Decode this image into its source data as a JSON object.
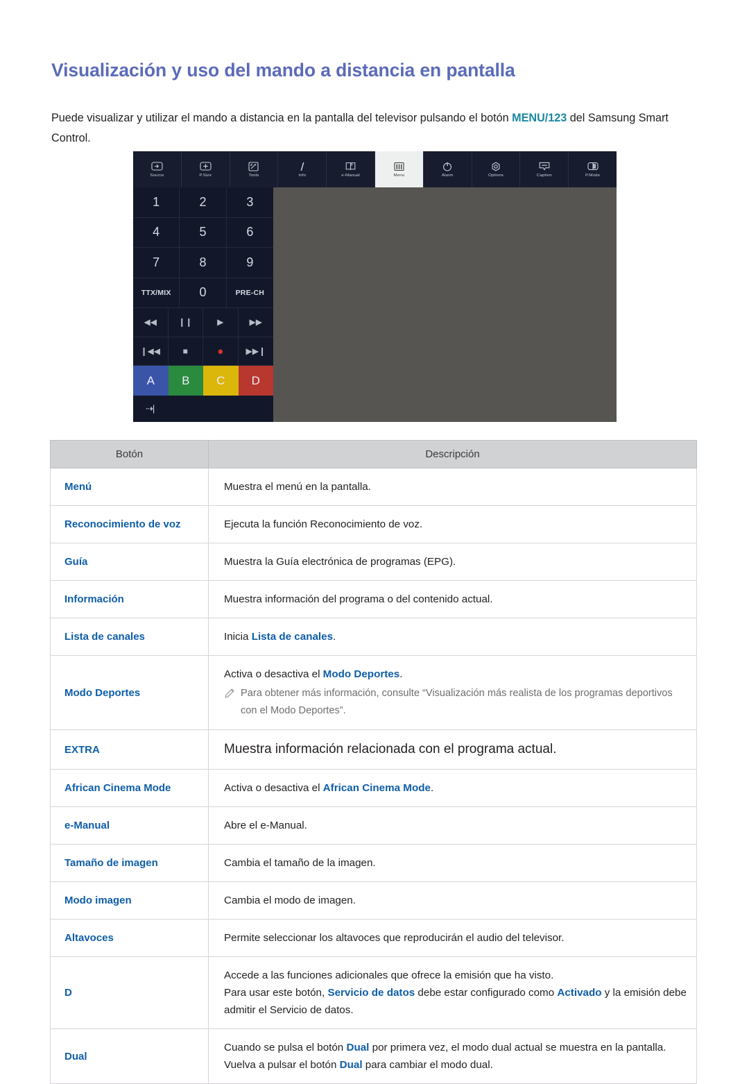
{
  "page": {
    "title": "Visualización y uso del mando a distancia en pantalla",
    "intro_before": "Puede visualizar y utilizar el mando a distancia en la pantalla del televisor pulsando el botón ",
    "intro_key": "MENU/123",
    "intro_after": " del Samsung Smart Control."
  },
  "colors": {
    "heading": "#5b6bb8",
    "key_accent": "#1a87a2",
    "link": "#0f5ea8",
    "table_header_bg": "#d0d2d3",
    "remote_panel_bg": "#575552",
    "remote_dark": "#121829",
    "color_a": "#3a54a8",
    "color_b": "#2a8a3e",
    "color_c": "#dbb60b",
    "color_d": "#b8372f"
  },
  "remote": {
    "topbar": [
      {
        "label": "Source",
        "icon": "source-icon",
        "active": false
      },
      {
        "label": "P.Size",
        "icon": "picture-size-icon",
        "active": false
      },
      {
        "label": "Tools",
        "icon": "tools-icon",
        "active": false
      },
      {
        "label": "Info",
        "icon": "info-icon",
        "active": false
      },
      {
        "label": "e-Manual",
        "icon": "e-manual-icon",
        "active": false
      },
      {
        "label": "Menu",
        "icon": "menu-icon",
        "active": true
      },
      {
        "label": "Alarm",
        "icon": "alarm-icon",
        "active": false
      },
      {
        "label": "Options",
        "icon": "options-icon",
        "active": false
      },
      {
        "label": "Caption",
        "icon": "caption-icon",
        "active": false
      },
      {
        "label": "P.Mode",
        "icon": "picture-mode-icon",
        "active": false
      }
    ],
    "numpad": [
      "1",
      "2",
      "3",
      "4",
      "5",
      "6",
      "7",
      "8",
      "9",
      "TTX/MIX",
      "0",
      "PRE-CH"
    ],
    "media_row1": [
      {
        "glyph": "◀◀",
        "name": "rewind"
      },
      {
        "glyph": "❙❙",
        "name": "pause"
      },
      {
        "glyph": "▶",
        "name": "play"
      },
      {
        "glyph": "▶▶",
        "name": "fast-forward"
      }
    ],
    "media_row2": [
      {
        "glyph": "❙◀◀",
        "name": "previous"
      },
      {
        "glyph": "■",
        "name": "stop"
      },
      {
        "glyph": "●",
        "name": "record"
      },
      {
        "glyph": "▶▶❙",
        "name": "next"
      }
    ],
    "color_buttons": [
      {
        "label": "A",
        "color": "#3a54a8"
      },
      {
        "label": "B",
        "color": "#2a8a3e"
      },
      {
        "label": "C",
        "color": "#dbb60b"
      },
      {
        "label": "D",
        "color": "#b8372f"
      }
    ],
    "bottom_button": {
      "label": "⇢|",
      "name": "exit-arrow"
    }
  },
  "table": {
    "headers": [
      "Botón",
      "Descripción"
    ],
    "rows": [
      {
        "name": "Menú",
        "desc_parts": [
          {
            "t": "Muestra el menú en la pantalla.",
            "link": false
          }
        ]
      },
      {
        "name": "Reconocimiento de voz",
        "desc_parts": [
          {
            "t": "Ejecuta la función Reconocimiento de voz.",
            "link": false
          }
        ]
      },
      {
        "name": "Guía",
        "desc_parts": [
          {
            "t": "Muestra la Guía electrónica de programas (EPG).",
            "link": false
          }
        ]
      },
      {
        "name": "Información",
        "desc_parts": [
          {
            "t": "Muestra información del programa o del contenido actual.",
            "link": false
          }
        ]
      },
      {
        "name": "Lista de canales",
        "desc_parts": [
          {
            "t": "Inicia ",
            "link": false
          },
          {
            "t": "Lista de canales",
            "link": true
          },
          {
            "t": ".",
            "link": false
          }
        ]
      },
      {
        "name": "Modo Deportes",
        "desc_parts": [
          {
            "t": "Activa o desactiva el ",
            "link": false
          },
          {
            "t": "Modo Deportes",
            "link": true
          },
          {
            "t": ".",
            "link": false
          }
        ],
        "note": "Para obtener más información, consulte “Visualización más realista de los programas deportivos con el Modo Deportes”."
      },
      {
        "name": "EXTRA",
        "big": true,
        "desc_parts": [
          {
            "t": "Muestra información relacionada con el programa actual.",
            "link": false
          }
        ]
      },
      {
        "name": "African Cinema Mode",
        "desc_parts": [
          {
            "t": "Activa o desactiva el ",
            "link": false
          },
          {
            "t": "African Cinema Mode",
            "link": true
          },
          {
            "t": ".",
            "link": false
          }
        ]
      },
      {
        "name": "e-Manual",
        "desc_parts": [
          {
            "t": "Abre el e-Manual.",
            "link": false
          }
        ]
      },
      {
        "name": "Tamaño de imagen",
        "desc_parts": [
          {
            "t": "Cambia el tamaño de la imagen.",
            "link": false
          }
        ]
      },
      {
        "name": "Modo imagen",
        "desc_parts": [
          {
            "t": "Cambia el modo de imagen.",
            "link": false
          }
        ]
      },
      {
        "name": "Altavoces",
        "desc_parts": [
          {
            "t": "Permite seleccionar los altavoces que reproducirán el audio del televisor.",
            "link": false
          }
        ]
      },
      {
        "name": "D",
        "desc_lines": [
          [
            {
              "t": "Accede a las funciones adicionales que ofrece la emisión que ha visto.",
              "link": false
            }
          ],
          [
            {
              "t": "Para usar este botón, ",
              "link": false
            },
            {
              "t": "Servicio de datos",
              "link": true
            },
            {
              "t": " debe estar configurado como ",
              "link": false
            },
            {
              "t": "Activado",
              "link": true
            },
            {
              "t": " y la emisión debe admitir el Servicio de datos.",
              "link": false
            }
          ]
        ]
      },
      {
        "name": "Dual",
        "desc_lines": [
          [
            {
              "t": "Cuando se pulsa el botón ",
              "link": false
            },
            {
              "t": "Dual",
              "link": true
            },
            {
              "t": " por primera vez, el modo dual actual se muestra en la pantalla.",
              "link": false
            }
          ],
          [
            {
              "t": "Vuelva a pulsar el botón ",
              "link": false
            },
            {
              "t": "Dual",
              "link": true
            },
            {
              "t": " para cambiar el modo dual.",
              "link": false
            }
          ]
        ]
      }
    ]
  }
}
